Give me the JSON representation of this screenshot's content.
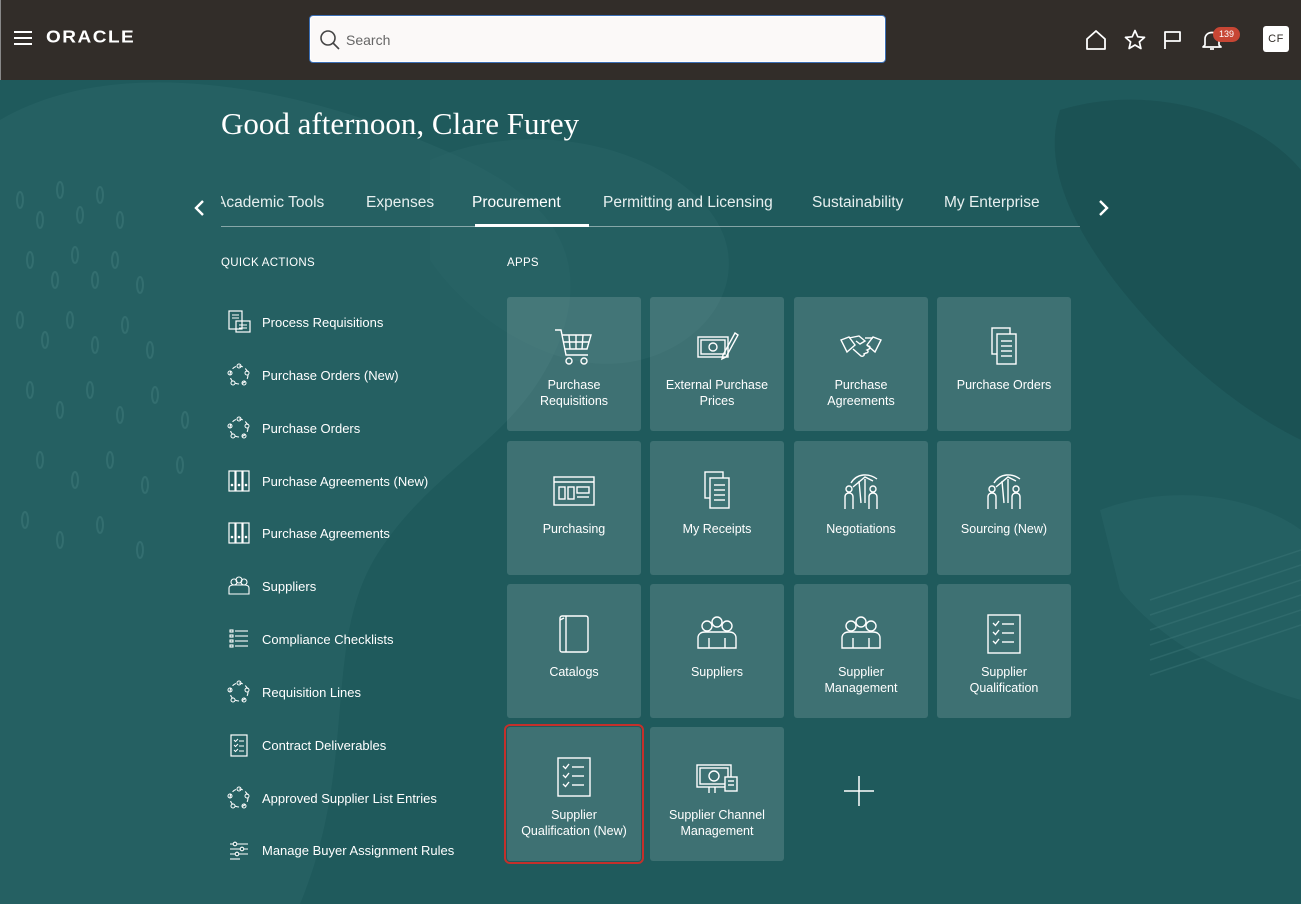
{
  "header": {
    "logo": "ORACLE",
    "search_placeholder": "Search",
    "notification_count": "139",
    "avatar_initials": "CF"
  },
  "greeting": "Good afternoon, Clare Furey",
  "tabs": [
    {
      "label": "Academic Tools"
    },
    {
      "label": "Expenses"
    },
    {
      "label": "Procurement"
    },
    {
      "label": "Permitting and Licensing"
    },
    {
      "label": "Sustainability"
    },
    {
      "label": "My Enterprise"
    }
  ],
  "active_tab": "Procurement",
  "quick_actions_heading": "QUICK ACTIONS",
  "apps_heading": "APPS",
  "quick_actions": [
    {
      "label": "Process Requisitions",
      "icon": "requisition-icon"
    },
    {
      "label": "Purchase Orders (New)",
      "icon": "circle-network-icon"
    },
    {
      "label": "Purchase Orders",
      "icon": "circle-network-icon"
    },
    {
      "label": "Purchase Agreements (New)",
      "icon": "binders-icon"
    },
    {
      "label": "Purchase Agreements",
      "icon": "binders-icon"
    },
    {
      "label": "Suppliers",
      "icon": "people-group-icon"
    },
    {
      "label": "Compliance Checklists",
      "icon": "checklist-lines-icon"
    },
    {
      "label": "Requisition Lines",
      "icon": "circle-network-icon"
    },
    {
      "label": "Contract Deliverables",
      "icon": "clipboard-check-icon"
    },
    {
      "label": "Approved Supplier List Entries",
      "icon": "circle-network-icon"
    },
    {
      "label": "Manage Buyer Assignment Rules",
      "icon": "sliders-icon"
    }
  ],
  "apps": [
    {
      "label": "Purchase Requisitions",
      "icon": "shopping-cart-icon"
    },
    {
      "label": "External Purchase Prices",
      "icon": "money-pen-icon"
    },
    {
      "label": "Purchase Agreements",
      "icon": "handshake-icon"
    },
    {
      "label": "Purchase Orders",
      "icon": "document-stack-icon"
    },
    {
      "label": "Purchasing",
      "icon": "dashboard-window-icon"
    },
    {
      "label": "My Receipts",
      "icon": "document-stack-icon"
    },
    {
      "label": "Negotiations",
      "icon": "negotiation-icon"
    },
    {
      "label": "Sourcing (New)",
      "icon": "negotiation-icon"
    },
    {
      "label": "Catalogs",
      "icon": "book-icon"
    },
    {
      "label": "Suppliers",
      "icon": "people-group-icon"
    },
    {
      "label": "Supplier Management",
      "icon": "people-group-icon"
    },
    {
      "label": "Supplier Qualification",
      "icon": "checklist-icon"
    },
    {
      "label": "Supplier Qualification (New)",
      "icon": "checklist-icon"
    },
    {
      "label": "Supplier Channel Management",
      "icon": "money-channel-icon"
    }
  ],
  "selected_app": "Supplier Qualification (New)",
  "colors": {
    "header_bg": "#322d29",
    "page_bg": "#1f5a5c",
    "badge": "#c74634",
    "selected_outline": "#c4302b"
  }
}
